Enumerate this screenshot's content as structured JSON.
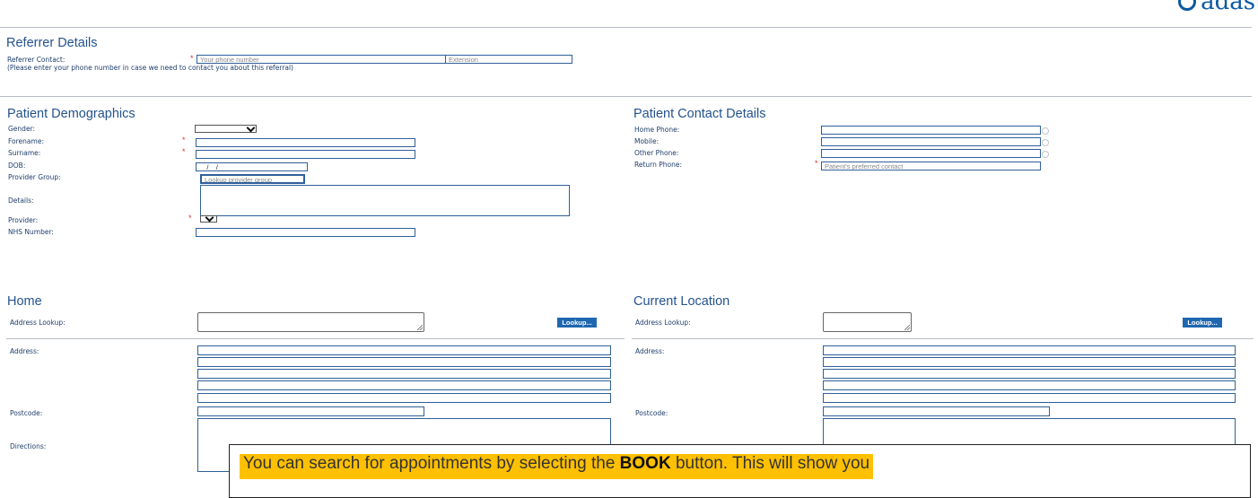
{
  "brand": {
    "name": "adastra"
  },
  "referrer": {
    "heading": "Referrer Details",
    "contact_label": "Referrer Contact:",
    "note": "(Please enter your phone number in case we need to contact you about this referral)",
    "phone_placeholder": "Your phone number",
    "extension_placeholder": "Extension",
    "required_mark": "*"
  },
  "demographics": {
    "heading": "Patient Demographics",
    "gender_label": "Gender:",
    "forename_label": "Forename:",
    "surname_label": "Surname:",
    "dob_label": "DOB:",
    "dob_mask": "__/__/____",
    "provider_group_label": "Provider Group:",
    "provider_group_placeholder": "Lookup provider group",
    "details_label": "Details:",
    "provider_label": "Provider:",
    "nhs_label": "NHS Number:",
    "required_mark": "*"
  },
  "contact": {
    "heading": "Patient Contact Details",
    "home_phone_label": "Home Phone:",
    "mobile_label": "Mobile:",
    "other_phone_label": "Other Phone:",
    "return_phone_label": "Return Phone:",
    "return_phone_placeholder": "Patient's preferred contact",
    "required_mark": "*"
  },
  "home": {
    "heading": "Home",
    "address_lookup_label": "Address Lookup:",
    "lookup_button": "Lookup...",
    "address_label": "Address:",
    "postcode_label": "Postcode:",
    "directions_label": "Directions:"
  },
  "current_location": {
    "heading": "Current Location",
    "address_lookup_label": "Address Lookup:",
    "lookup_button": "Lookup...",
    "address_label": "Address:",
    "postcode_label": "Postcode:"
  },
  "callout": {
    "text_before": "You can search for appointments by selecting the ",
    "text_bold": "BOOK",
    "text_after": " button. This will show you"
  },
  "colors": {
    "accent": "#1f67b0",
    "heading": "#24528f",
    "required": "#e0302b",
    "highlight": "#ffc000"
  }
}
